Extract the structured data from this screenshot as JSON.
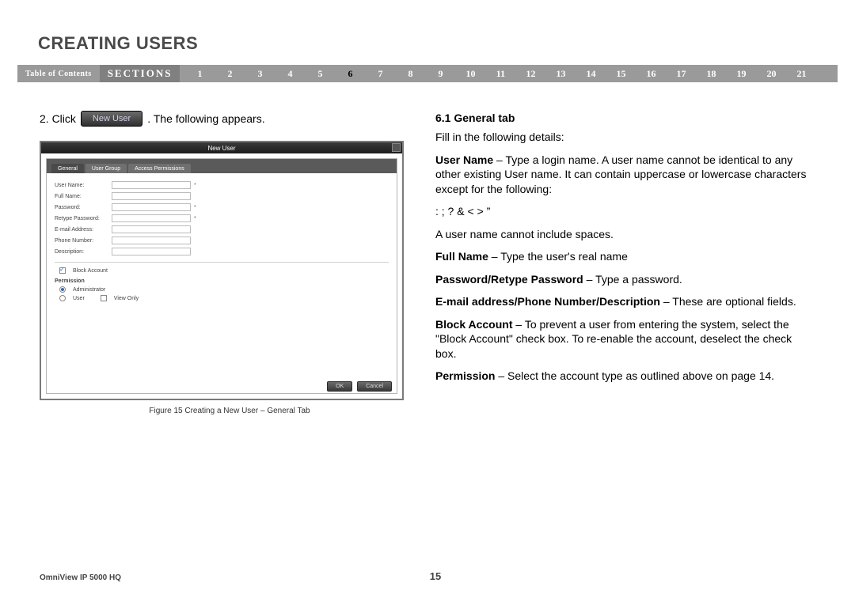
{
  "heading": "CREATING USERS",
  "nav": {
    "toc": "Table of Contents",
    "sections_label": "SECTIONS",
    "current": 6,
    "items": [
      "1",
      "2",
      "3",
      "4",
      "5",
      "6",
      "7",
      "8",
      "9",
      "10",
      "11",
      "12",
      "13",
      "14",
      "15",
      "16",
      "17",
      "18",
      "19",
      "20",
      "21"
    ]
  },
  "left": {
    "step_prefix": "2. Click",
    "inline_button": "New User",
    "step_suffix": ". The following appears.",
    "dialog": {
      "title": "New User",
      "tabs": [
        "General",
        "User Group",
        "Access Permissions"
      ],
      "fields": [
        {
          "label": "User Name:",
          "required": true
        },
        {
          "label": "Full Name:",
          "required": false
        },
        {
          "label": "Password:",
          "required": true
        },
        {
          "label": "Retype Password:",
          "required": true
        },
        {
          "label": "E-mail Address:",
          "required": false
        },
        {
          "label": "Phone Number:",
          "required": false
        },
        {
          "label": "Description:",
          "required": false
        }
      ],
      "block_account": "Block Account",
      "permission_label": "Permission",
      "perm_admin": "Administrator",
      "perm_user": "User",
      "perm_viewonly": "View Only",
      "ok": "OK",
      "cancel": "Cancel"
    },
    "caption": "Figure 15 Creating a New User – General Tab"
  },
  "right": {
    "h": "6.1 General tab",
    "p1": "Fill in the following details:",
    "username_label": "User Name",
    "username_text": " – Type a login name. A user name cannot be identical to any other existing User name. It can contain uppercase or lowercase characters except for the following:",
    "chars": ":   ;   ?   &   <   >   ”",
    "nospaces": "A user name cannot include spaces.",
    "fullname_label": "Full Name",
    "fullname_text": " – Type the user's real name",
    "pw_label": "Password/Retype Password",
    "pw_text": " – Type a password.",
    "opt_label": "E-mail address/Phone Number/Description",
    "opt_text": " – These are optional fields.",
    "block_label": "Block Account",
    "block_text": " – To prevent a user from entering the system, select the \"Block Account\" check box. To re-enable the account, deselect the check box.",
    "perm_label": "Permission",
    "perm_text": " – Select the account type as outlined above on page 14."
  },
  "footer": {
    "product": "OmniView IP 5000 HQ",
    "page": "15"
  }
}
